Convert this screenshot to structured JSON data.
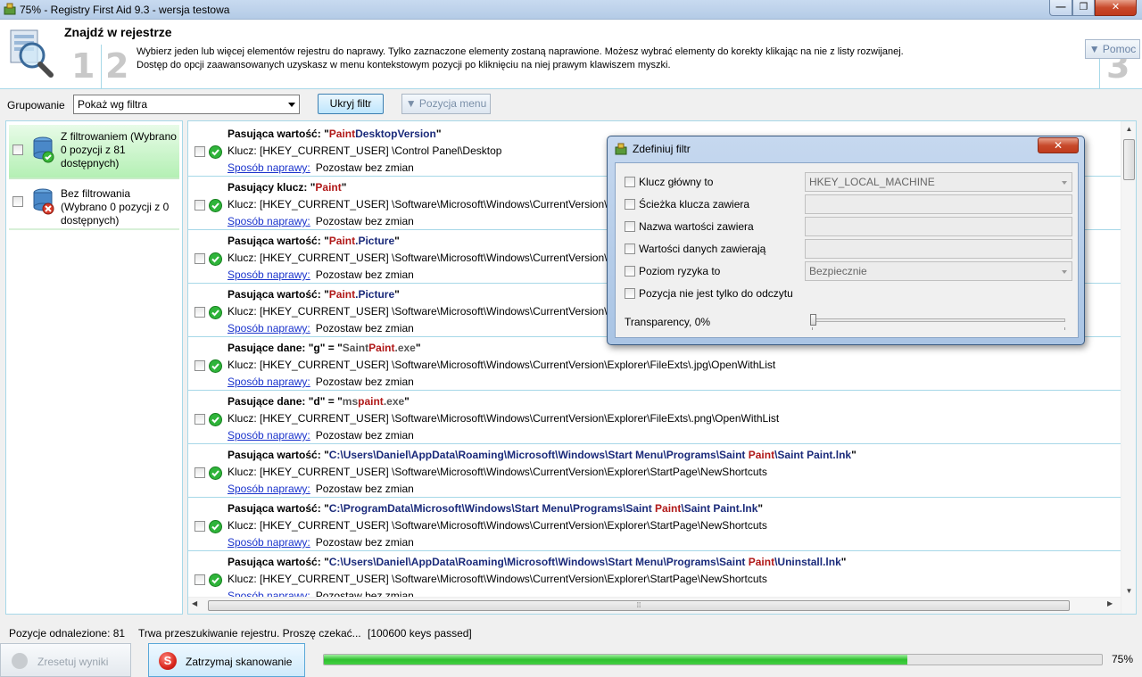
{
  "window": {
    "title": "75% - Registry First Aid 9.3 - wersja testowa",
    "min_glyph": "—",
    "max_glyph": "❐",
    "close_glyph": "✕"
  },
  "header": {
    "title": "Znajdź w rejestrze",
    "step1": "1",
    "step2": "2",
    "step3": "3",
    "desc_line1": "Wybierz jeden lub więcej elementów rejestru do naprawy. Tylko zaznaczone elementy zostaną naprawione. Możesz wybrać elementy do korekty klikając na nie z listy rozwijanej.",
    "desc_line2": "Dostęp do opcji zaawansowanych uzyskasz w menu kontekstowym pozycji po kliknięciu na niej prawym klawiszem myszki.",
    "help_label": "▼ Pomoc"
  },
  "toolbar": {
    "group_label": "Grupowanie",
    "group_value": "Pokaż wg filtra",
    "filter_button": "Ukryj filtr",
    "menu_button": "▼ Pozycja menu"
  },
  "groups": [
    {
      "label": "Z filtrowaniem (Wybrano 0 pozycji z 81 dostępnych)"
    },
    {
      "label": "Bez filtrowania (Wybrano 0 pozycji z 0 dostępnych)"
    }
  ],
  "common": {
    "fix_link": "Sposób naprawy:",
    "fix_result": "Pozostaw bez zmian"
  },
  "items": [
    {
      "prefix": "Pasująca wartość: ",
      "q1": "\"",
      "pre": "",
      "hl": "Paint",
      "post": "DesktopVersion",
      "q2": "\"",
      "key": "Klucz: [HKEY_CURRENT_USER] \\Control Panel\\Desktop"
    },
    {
      "prefix": "Pasujący klucz: ",
      "q1": "\"",
      "pre": "",
      "hl": "Paint",
      "post": "",
      "q2": "\"",
      "key": "Klucz: [HKEY_CURRENT_USER] \\Software\\Microsoft\\Windows\\CurrentVersion\\Ap"
    },
    {
      "prefix": "Pasująca wartość: ",
      "q1": "\"",
      "pre": "",
      "hl": "Paint",
      "post": ".Picture",
      "q2": "\"",
      "key": "Klucz: [HKEY_CURRENT_USER] \\Software\\Microsoft\\Windows\\CurrentVersion\\Exp"
    },
    {
      "prefix": "Pasująca wartość: ",
      "q1": "\"",
      "pre": "",
      "hl": "Paint",
      "post": ".Picture",
      "q2": "\"",
      "key": "Klucz: [HKEY_CURRENT_USER] \\Software\\Microsoft\\Windows\\CurrentVersion\\Exp"
    },
    {
      "prefix": "Pasujące dane: \"g\" = ",
      "q1": "\"",
      "pre": "Saint",
      "hl": "Paint",
      "post": ".exe",
      "q2": "\"",
      "key": "Klucz: [HKEY_CURRENT_USER] \\Software\\Microsoft\\Windows\\CurrentVersion\\Explorer\\FileExts\\.jpg\\OpenWithList",
      "gray": true
    },
    {
      "prefix": "Pasujące dane: \"d\" = ",
      "q1": "\"",
      "pre": "ms",
      "hl": "paint",
      "post": ".exe",
      "q2": "\"",
      "key": "Klucz: [HKEY_CURRENT_USER] \\Software\\Microsoft\\Windows\\CurrentVersion\\Explorer\\FileExts\\.png\\OpenWithList",
      "gray": true
    },
    {
      "prefix": "Pasująca wartość: ",
      "q1": "\"",
      "pre": "C:\\Users\\Daniel\\AppData\\Roaming\\Microsoft\\Windows\\Start Menu\\Programs\\Saint ",
      "hl": "Paint",
      "post": "\\Saint Paint.lnk",
      "q2": "\"",
      "key": "Klucz: [HKEY_CURRENT_USER] \\Software\\Microsoft\\Windows\\CurrentVersion\\Explorer\\StartPage\\NewShortcuts"
    },
    {
      "prefix": "Pasująca wartość: ",
      "q1": "\"",
      "pre": "C:\\ProgramData\\Microsoft\\Windows\\Start Menu\\Programs\\Saint ",
      "hl": "Paint",
      "post": "\\Saint Paint.lnk",
      "q2": "\"",
      "key": "Klucz: [HKEY_CURRENT_USER] \\Software\\Microsoft\\Windows\\CurrentVersion\\Explorer\\StartPage\\NewShortcuts"
    },
    {
      "prefix": "Pasująca wartość: ",
      "q1": "\"",
      "pre": "C:\\Users\\Daniel\\AppData\\Roaming\\Microsoft\\Windows\\Start Menu\\Programs\\Saint ",
      "hl": "Paint",
      "post": "\\Uninstall.lnk",
      "q2": "\"",
      "key": "Klucz: [HKEY_CURRENT_USER] \\Software\\Microsoft\\Windows\\CurrentVersion\\Explorer\\StartPage\\NewShortcuts"
    }
  ],
  "dialog": {
    "title": "Zdefiniuj filtr",
    "close_glyph": "✕",
    "rows": [
      {
        "label": "Klucz główny to",
        "value": "HKEY_LOCAL_MACHINE",
        "kind": "select"
      },
      {
        "label": "Ścieżka klucza zawiera",
        "value": "",
        "kind": "text"
      },
      {
        "label": "Nazwa wartości zawiera",
        "value": "",
        "kind": "text"
      },
      {
        "label": "Wartości danych zawierają",
        "value": "",
        "kind": "text"
      },
      {
        "label": "Poziom ryzyka to",
        "value": "Bezpiecznie",
        "kind": "select"
      },
      {
        "label": "Pozycja nie jest tylko do odczytu",
        "value": null,
        "kind": "none"
      }
    ],
    "transparency_label": "Transparency, 0%",
    "transparency_value": 0
  },
  "status": {
    "found": "Pozycje odnalezione: 81",
    "scanning": "Trwa przeszukiwanie rejestru. Proszę czekać...",
    "keys": "[100600 keys passed]"
  },
  "bottom": {
    "reset_button": "Zresetuj wyniki",
    "stop_button": "Zatrzymaj skanowanie",
    "stop_glyph": "S",
    "progress": 0.75,
    "progress_label": "75%"
  },
  "scroll": {
    "up_glyph": "▲",
    "down_glyph": "▼",
    "left_glyph": "◀",
    "right_glyph": "▶",
    "grip_glyph": "⁞⁞"
  },
  "colors": {
    "accent_border": "#a7d8e8",
    "highlight_text": "#b01818",
    "value_text": "#1a2a7a",
    "progress_green": "#2fc02f"
  }
}
